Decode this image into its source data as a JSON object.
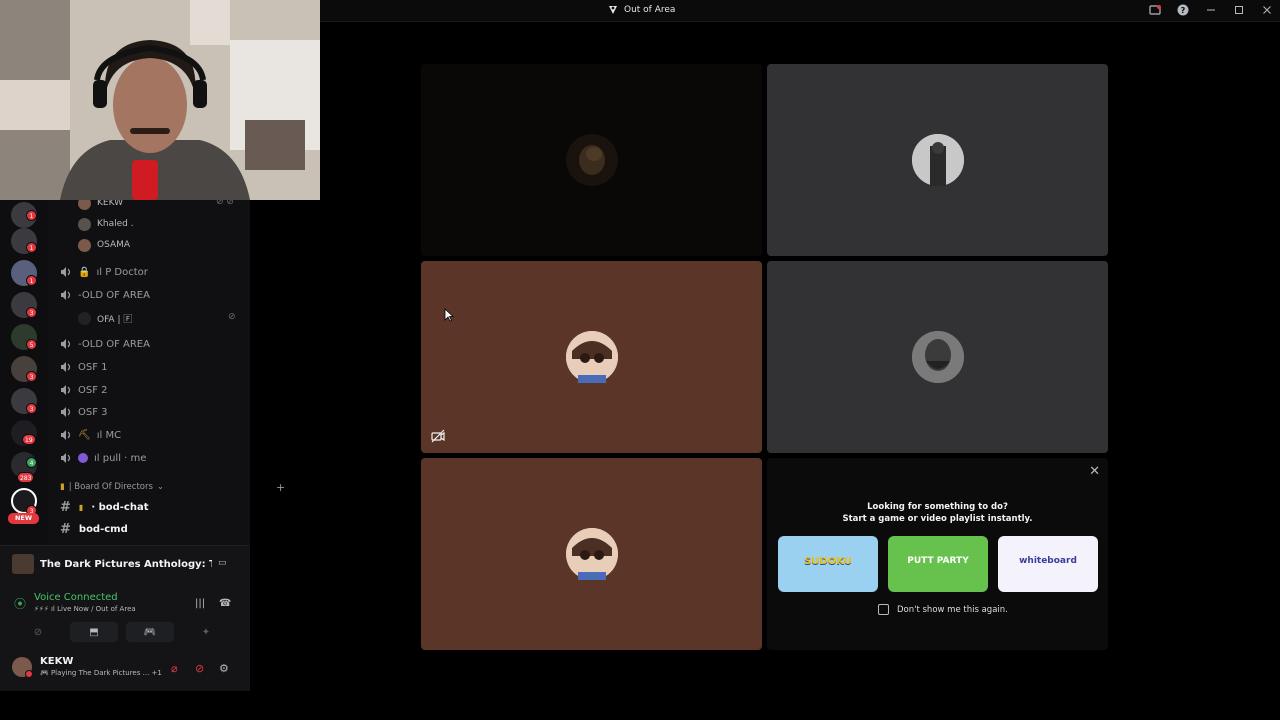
{
  "window": {
    "title": "Out of Area"
  },
  "guild_badges": [
    "1",
    "1",
    "1",
    "3",
    "5",
    "3",
    "3",
    "19",
    "4",
    "283",
    "3"
  ],
  "new_badge": "NEW",
  "members_top": [
    {
      "name": "KEKW"
    },
    {
      "name": "Khaled ."
    },
    {
      "name": "OSAMA"
    }
  ],
  "voice_channels": [
    {
      "name": "ıl P Doctor",
      "prefix_icon": "lock-icon"
    },
    {
      "name": "-OLD OF AREA"
    },
    {
      "name": "-OLD OF AREA"
    },
    {
      "name": "OSF 1"
    },
    {
      "name": "OSF 2"
    },
    {
      "name": "OSF 3"
    },
    {
      "name": "ıl MC",
      "prefix_icon": "pickaxe-icon"
    },
    {
      "name": "ıl pull · me",
      "prefix_icon": "purple-dot-icon"
    }
  ],
  "voice_member": {
    "name": "OFA | 🄵"
  },
  "category": {
    "name": "| Board Of Directors"
  },
  "text_channels": [
    {
      "name": "· bod-chat"
    },
    {
      "name": "bod-cmd"
    }
  ],
  "panel": {
    "activity_name": "The Dark Pictures Anthology: The D...",
    "voice_status": "Voice Connected",
    "voice_location": "⚡⚡⚡ ıl Live Now / Out of Area",
    "user_name": "KEKW",
    "user_status": "🎮 Playing The Dark Pictures ... +1"
  },
  "suggestion": {
    "line1": "Looking for something to do?",
    "line2": "Start a game or video playlist instantly.",
    "activities": [
      {
        "label": "SUDOKU",
        "icon": "sudoku-card"
      },
      {
        "label": "PUTT PARTY",
        "icon": "putt-party-card"
      },
      {
        "label": "whiteboard",
        "icon": "whiteboard-card"
      }
    ],
    "checkbox_label": "Don't show me this again."
  },
  "colors": {
    "tile_brown": "#5a3528",
    "tile_grey": "#323235",
    "tile_dark": "#0a0806",
    "voice_green": "#45c46a",
    "danger_red": "#e2383f"
  }
}
